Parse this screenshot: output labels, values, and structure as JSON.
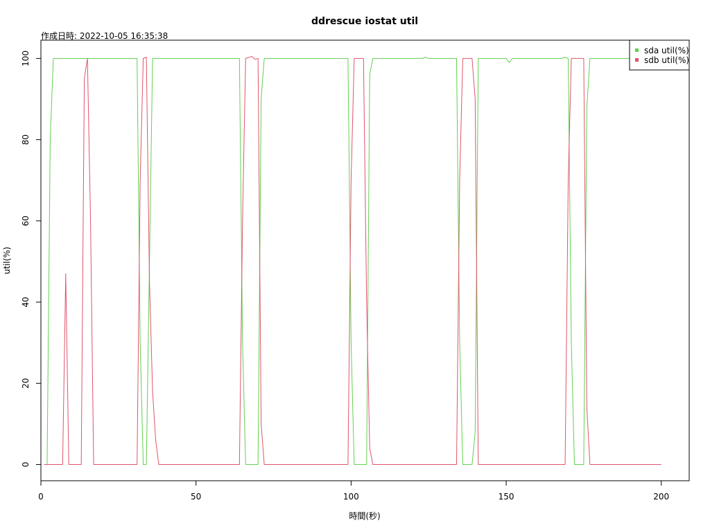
{
  "chart_data": {
    "type": "line",
    "title": "ddrescue iostat util",
    "subtitle": "作成日時: 2022-10-05 16:35:38",
    "xlabel": "時間(秒)",
    "ylabel": "util(%)",
    "xlim": [
      0,
      209
    ],
    "ylim": [
      -4,
      104.5
    ],
    "xticks": [
      0,
      50,
      100,
      150,
      200
    ],
    "yticks": [
      0,
      20,
      40,
      60,
      80,
      100
    ],
    "grid": false,
    "legend_position": "top-right",
    "series": [
      {
        "name": "sda util(%)",
        "color": "#61d04f",
        "points": [
          [
            1,
            0
          ],
          [
            2,
            0
          ],
          [
            3,
            80
          ],
          [
            4,
            100
          ],
          [
            31,
            100
          ],
          [
            32,
            30
          ],
          [
            33,
            0
          ],
          [
            34,
            0
          ],
          [
            35,
            50
          ],
          [
            36,
            100
          ],
          [
            64,
            100
          ],
          [
            65,
            30
          ],
          [
            66,
            0
          ],
          [
            70,
            0
          ],
          [
            71,
            90
          ],
          [
            72,
            100
          ],
          [
            99,
            100
          ],
          [
            100,
            30
          ],
          [
            101,
            0
          ],
          [
            105,
            0
          ],
          [
            106,
            96
          ],
          [
            107,
            100
          ],
          [
            123,
            100
          ],
          [
            124,
            100.3
          ],
          [
            125,
            100
          ],
          [
            134,
            100
          ],
          [
            135,
            30
          ],
          [
            136,
            0
          ],
          [
            139,
            0
          ],
          [
            140,
            8
          ],
          [
            141,
            100
          ],
          [
            150,
            100
          ],
          [
            151,
            99
          ],
          [
            152,
            100
          ],
          [
            168,
            100
          ],
          [
            169,
            100.3
          ],
          [
            170,
            100
          ],
          [
            171,
            30
          ],
          [
            172,
            0
          ],
          [
            175,
            0
          ],
          [
            176,
            88
          ],
          [
            177,
            100
          ],
          [
            200,
            100
          ]
        ]
      },
      {
        "name": "sdb util(%)",
        "color": "#df536b",
        "points": [
          [
            1,
            0
          ],
          [
            7,
            0
          ],
          [
            8,
            47
          ],
          [
            9,
            0
          ],
          [
            13,
            0
          ],
          [
            14,
            95
          ],
          [
            15,
            100
          ],
          [
            16,
            60
          ],
          [
            17,
            0
          ],
          [
            31,
            0
          ],
          [
            32,
            70
          ],
          [
            33,
            100
          ],
          [
            34,
            100.3
          ],
          [
            35,
            45
          ],
          [
            36,
            18
          ],
          [
            37,
            6
          ],
          [
            38,
            0
          ],
          [
            64,
            0
          ],
          [
            65,
            60
          ],
          [
            66,
            100
          ],
          [
            68,
            100.5
          ],
          [
            69,
            99.8
          ],
          [
            70,
            100
          ],
          [
            71,
            10
          ],
          [
            72,
            0
          ],
          [
            99,
            0
          ],
          [
            100,
            70
          ],
          [
            101,
            100
          ],
          [
            104,
            100
          ],
          [
            105,
            40
          ],
          [
            106,
            4
          ],
          [
            107,
            0
          ],
          [
            134,
            0
          ],
          [
            135,
            70
          ],
          [
            136,
            100
          ],
          [
            139,
            100
          ],
          [
            140,
            90
          ],
          [
            141,
            0
          ],
          [
            169,
            0
          ],
          [
            170,
            70
          ],
          [
            171,
            100
          ],
          [
            175,
            100
          ],
          [
            176,
            14
          ],
          [
            177,
            0
          ],
          [
            200,
            0
          ]
        ]
      }
    ]
  }
}
